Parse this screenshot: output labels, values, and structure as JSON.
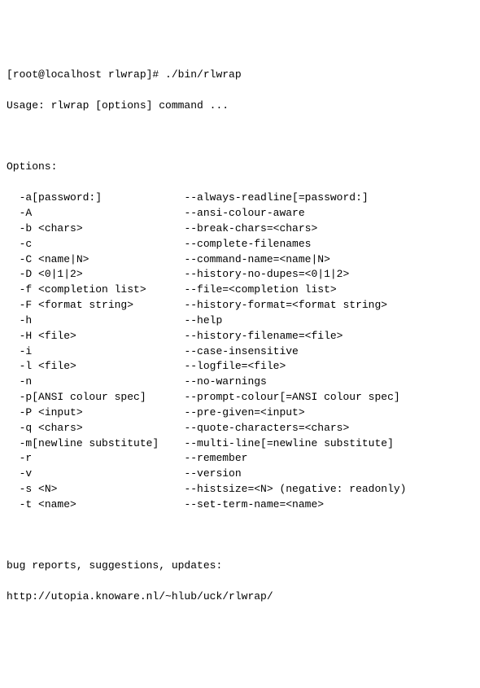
{
  "prompt": "[root@localhost rlwrap]# ",
  "command": "./bin/rlwrap",
  "usage": "Usage: rlwrap [options] command ...",
  "options_header": "Options:",
  "options": [
    {
      "short": "-a[password:]",
      "long": "--always-readline[=password:]"
    },
    {
      "short": "-A",
      "long": "--ansi-colour-aware"
    },
    {
      "short": "-b <chars>",
      "long": "--break-chars=<chars>"
    },
    {
      "short": "-c",
      "long": "--complete-filenames"
    },
    {
      "short": "-C <name|N>",
      "long": "--command-name=<name|N>"
    },
    {
      "short": "-D <0|1|2>",
      "long": "--history-no-dupes=<0|1|2>"
    },
    {
      "short": "-f <completion list>",
      "long": "--file=<completion list>"
    },
    {
      "short": "-F <format string>",
      "long": "--history-format=<format string>"
    },
    {
      "short": "-h",
      "long": "--help"
    },
    {
      "short": "-H <file>",
      "long": "--history-filename=<file>"
    },
    {
      "short": "-i",
      "long": "--case-insensitive"
    },
    {
      "short": "-l <file>",
      "long": "--logfile=<file>"
    },
    {
      "short": "-n",
      "long": "--no-warnings"
    },
    {
      "short": "-p[ANSI colour spec]",
      "long": "--prompt-colour[=ANSI colour spec]"
    },
    {
      "short": "-P <input>",
      "long": "--pre-given=<input>"
    },
    {
      "short": "-q <chars>",
      "long": "--quote-characters=<chars>"
    },
    {
      "short": "-m[newline substitute]",
      "long": "--multi-line[=newline substitute]"
    },
    {
      "short": "-r",
      "long": "--remember"
    },
    {
      "short": "-v",
      "long": "--version"
    },
    {
      "short": "-s <N>",
      "long": "--histsize=<N> (negative: readonly)"
    },
    {
      "short": "-t <name>",
      "long": "--set-term-name=<name>"
    }
  ],
  "footer1": "bug reports, suggestions, updates:",
  "footer2": "http://utopia.knoware.nl/~hlub/uck/rlwrap/"
}
